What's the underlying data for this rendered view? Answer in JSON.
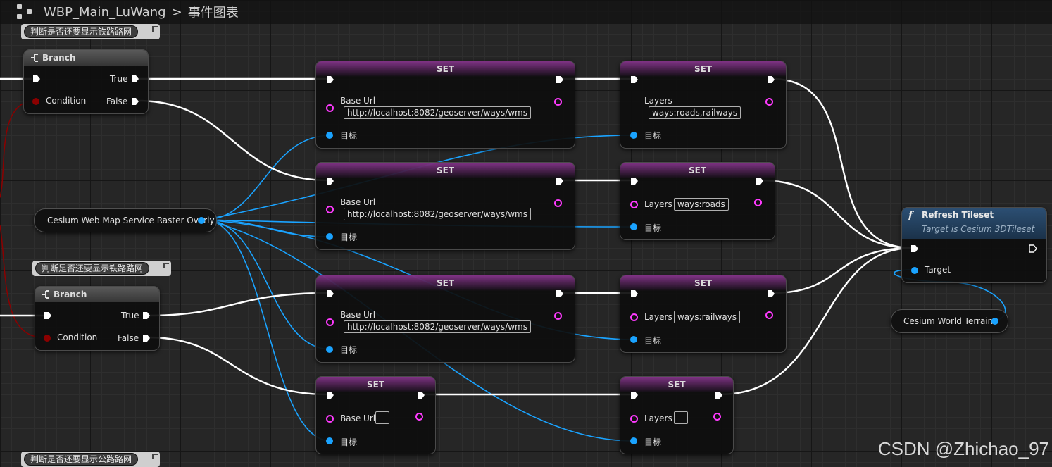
{
  "breadcrumb": {
    "blueprint": "WBP_Main_LuWang",
    "separator": ">",
    "graph": "事件图表"
  },
  "colors": {
    "exec_wire": "#ffffff",
    "object_wire": "#1aa3ff",
    "bool_wire": "#8b0000",
    "string_pin": "#ff3aff",
    "set_header": "#dc50e6",
    "func_header": "#2c4f73"
  },
  "comments": [
    {
      "text": "判断是否还要显示铁路路网"
    },
    {
      "text": "判断是否还要显示铁路路网"
    },
    {
      "text": "判断是否还要显示公路路网"
    }
  ],
  "branch_nodes": [
    {
      "title": "Branch",
      "true_label": "True",
      "false_label": "False",
      "condition_label": "Condition"
    },
    {
      "title": "Branch",
      "true_label": "True",
      "false_label": "False",
      "condition_label": "Condition"
    }
  ],
  "variables": {
    "wms_overlay": "Cesium Web Map Service Raster Overly",
    "world_terrain": "Cesium World Terrain"
  },
  "set_nodes": [
    {
      "title": "SET",
      "field_label": "Base Url",
      "value": "http://localhost:8082/geoserver/ways/wms",
      "target_label": "目标"
    },
    {
      "title": "SET",
      "field_label": "Base Url",
      "value": "http://localhost:8082/geoserver/ways/wms",
      "target_label": "目标"
    },
    {
      "title": "SET",
      "field_label": "Base Url",
      "value": "http://localhost:8082/geoserver/ways/wms",
      "target_label": "目标"
    },
    {
      "title": "SET",
      "field_label": "Base Url",
      "value": "",
      "target_label": "目标"
    },
    {
      "title": "SET",
      "field_label": "Layers",
      "value": "ways:roads,railways",
      "target_label": "目标"
    },
    {
      "title": "SET",
      "field_label": "Layers",
      "value": "ways:roads",
      "target_label": "目标"
    },
    {
      "title": "SET",
      "field_label": "Layers",
      "value": "ways:railways",
      "target_label": "目标"
    },
    {
      "title": "SET",
      "field_label": "Layers",
      "value": "",
      "target_label": "目标"
    }
  ],
  "function_node": {
    "icon": "f",
    "title": "Refresh Tileset",
    "subtitle": "Target is Cesium 3DTileset",
    "target_label": "Target"
  },
  "watermark": "CSDN @Zhichao_97"
}
